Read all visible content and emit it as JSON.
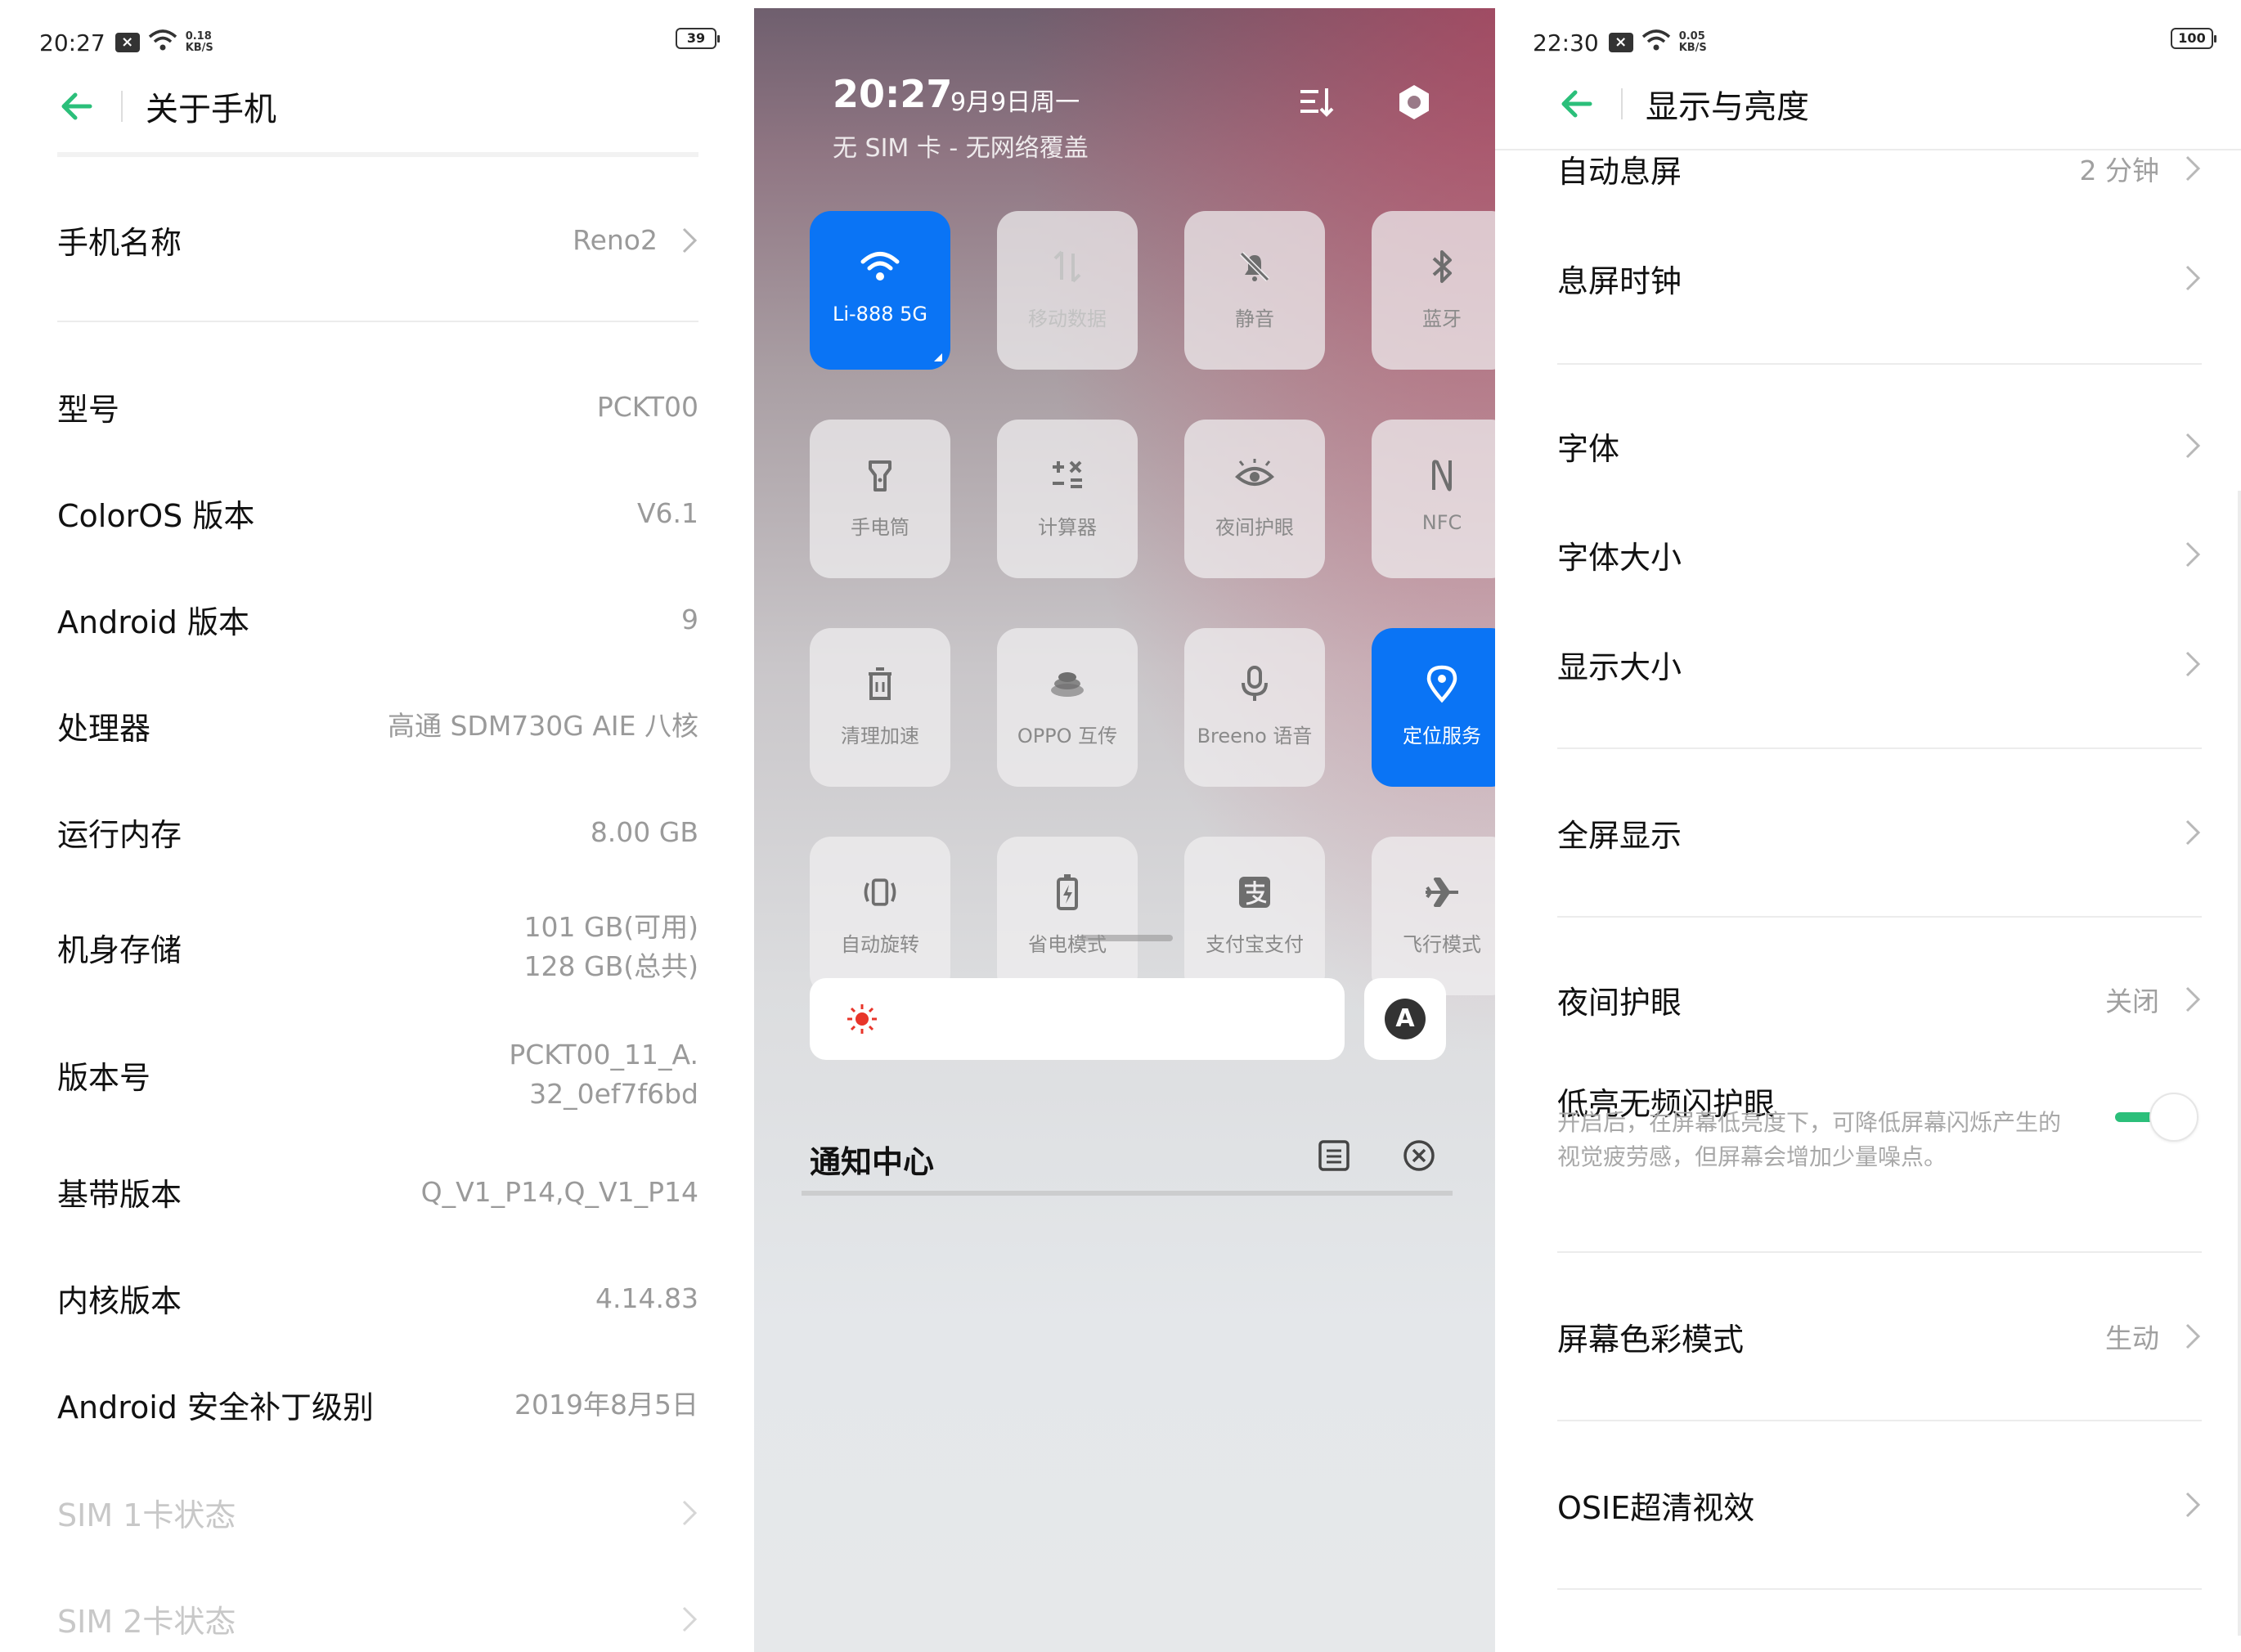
{
  "left": {
    "status": {
      "time": "20:27",
      "speed": "0.18\nKB/S",
      "battery": "39"
    },
    "header": {
      "title": "关于手机"
    },
    "rows": [
      {
        "label": "手机名称",
        "value": "Reno2",
        "chevron": true
      },
      {
        "label": "型号",
        "value": "PCKT00"
      },
      {
        "label": "ColorOS 版本",
        "value": "V6.1"
      },
      {
        "label": "Android 版本",
        "value": "9"
      },
      {
        "label": "处理器",
        "value": "高通 SDM730G AIE 八核"
      },
      {
        "label": "运行内存",
        "value": "8.00 GB"
      },
      {
        "label": "机身存储",
        "value": "101 GB(可用)",
        "value2": "128 GB(总共)"
      },
      {
        "label": "版本号",
        "value": "PCKT00_11_A.",
        "value2": "32_0ef7f6bd"
      },
      {
        "label": "基带版本",
        "value": "Q_V1_P14,Q_V1_P14"
      },
      {
        "label": "内核版本",
        "value": "4.14.83"
      },
      {
        "label": "Android 安全补丁级别",
        "value": "2019年8月5日"
      },
      {
        "label": "SIM 1卡状态",
        "value": "",
        "chevron": true
      },
      {
        "label": "SIM 2卡状态",
        "value": "",
        "chevron": true
      }
    ]
  },
  "mid": {
    "time": "20:27",
    "date": "9月9日周一",
    "sim": "无 SIM 卡 - 无网络覆盖",
    "tiles": [
      {
        "label": "Li-888 5G",
        "icon": "wifi-icon",
        "state": "on"
      },
      {
        "label": "移动数据",
        "icon": "mobile-data-icon",
        "state": "off"
      },
      {
        "label": "静音",
        "icon": "mute-icon",
        "state": "normal"
      },
      {
        "label": "蓝牙",
        "icon": "bluetooth-icon",
        "state": "normal"
      },
      {
        "label": "手电筒",
        "icon": "flashlight-icon",
        "state": "normal"
      },
      {
        "label": "计算器",
        "icon": "calculator-icon",
        "state": "normal"
      },
      {
        "label": "夜间护眼",
        "icon": "eye-icon",
        "state": "normal"
      },
      {
        "label": "NFC",
        "icon": "nfc-icon",
        "state": "normal"
      },
      {
        "label": "清理加速",
        "icon": "trash-icon",
        "state": "normal"
      },
      {
        "label": "OPPO 互传",
        "icon": "share-icon",
        "state": "normal"
      },
      {
        "label": "Breeno 语音",
        "icon": "microphone-icon",
        "state": "normal"
      },
      {
        "label": "定位服务",
        "icon": "location-icon",
        "state": "on"
      },
      {
        "label": "自动旋转",
        "icon": "rotate-icon",
        "state": "normal"
      },
      {
        "label": "省电模式",
        "icon": "battery-saver-icon",
        "state": "normal"
      },
      {
        "label": "支付宝支付",
        "icon": "alipay-icon",
        "state": "normal"
      },
      {
        "label": "飞行模式",
        "icon": "airplane-icon",
        "state": "normal"
      }
    ],
    "auto_brightness": "A",
    "notification_title": "通知中心"
  },
  "right": {
    "status": {
      "time": "22:30",
      "speed": "0.05\nKB/S",
      "battery": "100"
    },
    "header": {
      "title": "显示与亮度"
    },
    "rows": [
      {
        "label": "自动息屏",
        "value": "2 分钟"
      },
      {
        "label": "息屏时钟",
        "value": ""
      },
      {
        "label": "字体",
        "value": ""
      },
      {
        "label": "字体大小",
        "value": ""
      },
      {
        "label": "显示大小",
        "value": ""
      },
      {
        "label": "全屏显示",
        "value": ""
      },
      {
        "label": "夜间护眼",
        "value": "关闭"
      },
      {
        "label": "低亮无频闪护眼",
        "value": ""
      },
      {
        "label": "屏幕色彩模式",
        "value": "生动"
      },
      {
        "label": "OSIE超清视效",
        "value": ""
      }
    ],
    "flicker_desc": "开启后，在屏幕低亮度下，可降低屏幕闪烁产生的视觉疲劳感，但屏幕会增加少量噪点。",
    "flicker_toggle": true
  },
  "colors": {
    "accent_green": "#2bbf7a",
    "tile_blue": "#0a74f5"
  }
}
